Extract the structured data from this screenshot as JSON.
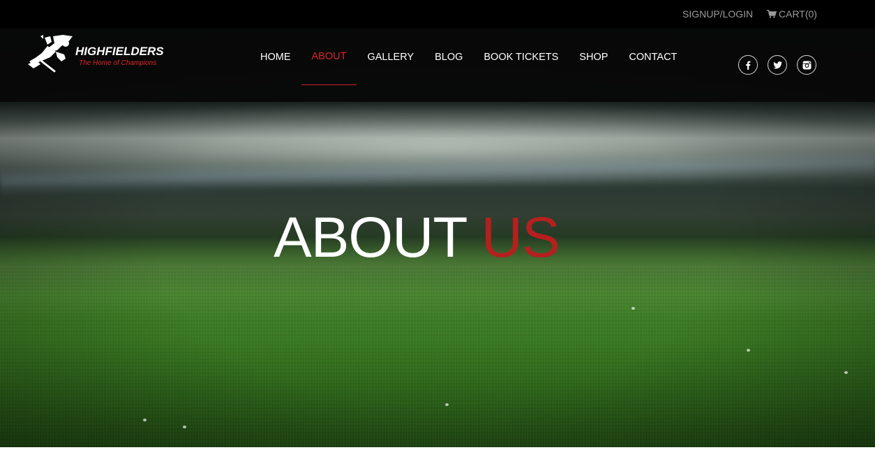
{
  "topbar": {
    "signup_label": "SIGNUP/LOGIN",
    "cart_label": "CART(0)",
    "cart_icon": "shopping-cart-icon"
  },
  "logo": {
    "brand": "HIGHFIELDERS",
    "tagline": "The Home of Champions"
  },
  "nav": {
    "items": [
      {
        "label": "HOME",
        "active": false
      },
      {
        "label": "ABOUT",
        "active": true
      },
      {
        "label": "GALLERY",
        "active": false
      },
      {
        "label": "BLOG",
        "active": false
      },
      {
        "label": "BOOK TICKETS",
        "active": false
      },
      {
        "label": "SHOP",
        "active": false
      },
      {
        "label": "CONTACT",
        "active": false
      }
    ]
  },
  "social": {
    "icons": [
      "facebook-icon",
      "twitter-icon",
      "instagram-icon"
    ]
  },
  "hero": {
    "title_main": "ABOUT",
    "title_accent": "US",
    "background": "stadium-pitch-photo"
  },
  "colors": {
    "accent": "#d6282d",
    "title_accent": "#b5201f",
    "topbar_bg": "#000000",
    "topbar_text": "#9b9b9b",
    "nav_text": "#ffffff"
  }
}
